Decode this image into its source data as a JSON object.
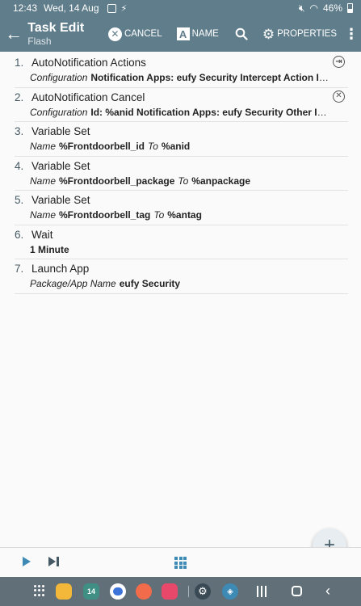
{
  "status_bar": {
    "time": "12:43",
    "date": "Wed, 14 Aug",
    "battery": "46%"
  },
  "app_bar": {
    "title": "Task Edit",
    "subtitle": "Flash",
    "cancel_label": "CANCEL",
    "name_label": "NAME",
    "properties_label": "PROPERTIES",
    "name_icon_letter": "A"
  },
  "tasks": [
    {
      "num": "1.",
      "name": "AutoNotification Actions",
      "detail_label": "Configuration",
      "detail_value": "Notification Apps: eufy Security Intercept Action ID: %anid Intercept Action Text: ...",
      "icon": "plugin-icon"
    },
    {
      "num": "2.",
      "name": "AutoNotification Cancel",
      "detail_label": "Configuration",
      "detail_value": "Id: %anid Notification Apps: eufy Security Other Id: %anid Package: ...",
      "icon": "close-circle-icon"
    },
    {
      "num": "3.",
      "name": "Variable Set",
      "detail_label": "Name",
      "detail_value": "%Frontdoorbell_id",
      "detail_mid": "To",
      "detail_value2": "%anid"
    },
    {
      "num": "4.",
      "name": "Variable Set",
      "detail_label": "Name",
      "detail_value": "%Frontdoorbell_package",
      "detail_mid": "To",
      "detail_value2": "%anpackage"
    },
    {
      "num": "5.",
      "name": "Variable Set",
      "detail_label": "Name",
      "detail_value": "%Frontdoorbell_tag",
      "detail_mid": "To",
      "detail_value2": "%antag"
    },
    {
      "num": "6.",
      "name": "Wait",
      "detail_value": "1 Minute"
    },
    {
      "num": "7.",
      "name": "Launch App",
      "detail_label": "Package/App Name",
      "detail_value": "eufy Security"
    }
  ],
  "fab": {
    "label": "+"
  },
  "dock": {
    "calendar_label": "14"
  },
  "colors": {
    "app_bar": "#607d8b",
    "nav_bar": "#616f79",
    "accent_blue": "#3d8ab5"
  }
}
